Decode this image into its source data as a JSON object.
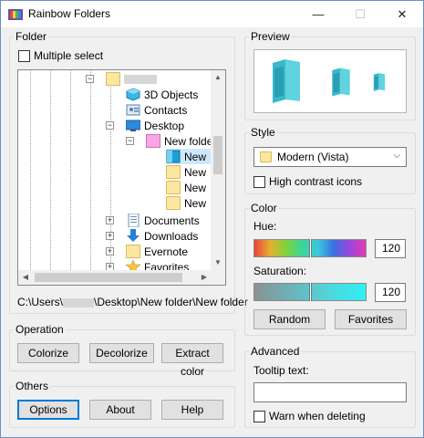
{
  "window": {
    "title": "Rainbow Folders",
    "minimize_glyph": "—",
    "maximize_glyph": "☐",
    "close_glyph": "✕"
  },
  "folder_group": {
    "label": "Folder",
    "multiple_select_label": "Multiple select",
    "tree": [
      {
        "label": "",
        "icon": "folder-icon",
        "masked": true
      },
      {
        "label": "3D Objects",
        "icon": "3d-objects-icon"
      },
      {
        "label": "Contacts",
        "icon": "contacts-icon"
      },
      {
        "label": "Desktop",
        "icon": "desktop-icon"
      },
      {
        "label": "New folde",
        "icon": "pink-folder-icon"
      },
      {
        "label": "New",
        "icon": "teal-folder-icon"
      },
      {
        "label": "New",
        "icon": "folder-icon"
      },
      {
        "label": "New",
        "icon": "folder-icon"
      },
      {
        "label": "New",
        "icon": "folder-icon"
      },
      {
        "label": "Documents",
        "icon": "documents-icon"
      },
      {
        "label": "Downloads",
        "icon": "downloads-icon"
      },
      {
        "label": "Evernote",
        "icon": "folder-icon"
      },
      {
        "label": "Favorites",
        "icon": "star-icon"
      }
    ],
    "path_prefix": "C:\\Users\\",
    "path_suffix": "\\Desktop\\New folder\\New folder"
  },
  "operation_group": {
    "label": "Operation",
    "colorize": "Colorize",
    "decolorize": "Decolorize",
    "extract_color": "Extract color"
  },
  "others_group": {
    "label": "Others",
    "options": "Options",
    "about": "About",
    "help": "Help"
  },
  "preview_group": {
    "label": "Preview"
  },
  "style_group": {
    "label": "Style",
    "selected_style": "Modern (Vista)",
    "high_contrast_label": "High contrast icons"
  },
  "color_group": {
    "label": "Color",
    "hue_label": "Hue:",
    "hue_value": "120",
    "saturation_label": "Saturation:",
    "saturation_value": "120",
    "random": "Random",
    "favorites": "Favorites",
    "accent_color": "#4fd6dc"
  },
  "advanced_group": {
    "label": "Advanced",
    "tooltip_label": "Tooltip text:",
    "tooltip_value": "",
    "warn_label": "Warn when deleting"
  }
}
